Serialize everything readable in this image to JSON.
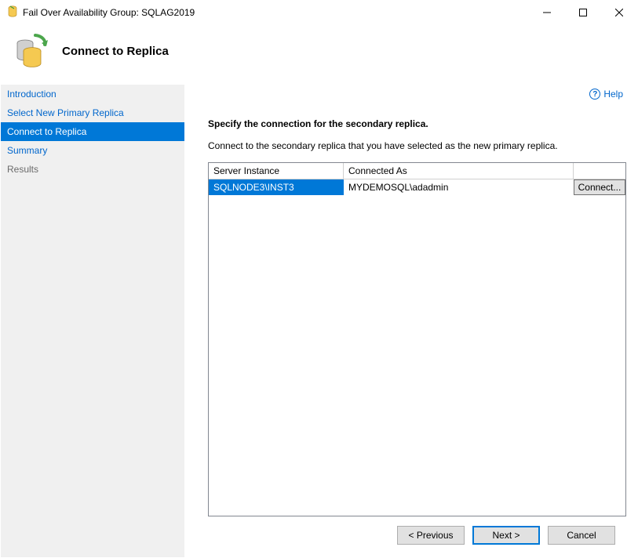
{
  "window": {
    "title": "Fail Over Availability Group: SQLAG2019"
  },
  "header": {
    "title": "Connect to Replica"
  },
  "sidebar": {
    "items": [
      {
        "label": "Introduction"
      },
      {
        "label": "Select New Primary Replica"
      },
      {
        "label": "Connect to Replica"
      },
      {
        "label": "Summary"
      },
      {
        "label": "Results"
      }
    ]
  },
  "help": {
    "label": "Help"
  },
  "content": {
    "heading": "Specify the connection for the secondary replica.",
    "sub": "Connect to the secondary replica that you have selected as the new primary replica."
  },
  "table": {
    "headers": {
      "server": "Server Instance",
      "connected_as": "Connected As"
    },
    "rows": [
      {
        "server": "SQLNODE3\\INST3",
        "connected_as": "MYDEMOSQL\\adadmin",
        "connect_label": "Connect..."
      }
    ]
  },
  "footer": {
    "previous": "< Previous",
    "next": "Next >",
    "cancel": "Cancel"
  }
}
